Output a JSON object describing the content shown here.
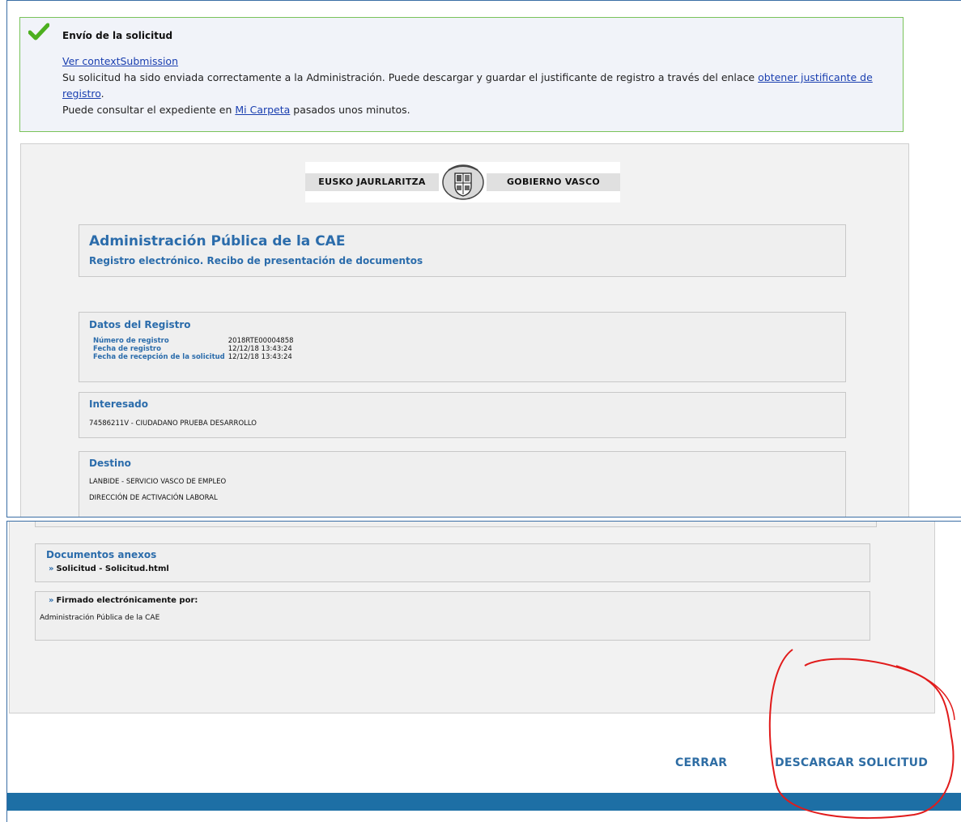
{
  "notification": {
    "title": "Envío de la solicitud",
    "context_link": "Ver contextSubmission",
    "line1_pre": "Su solicitud ha sido enviada correctamente a la Administración. Puede descargar y guardar el justificante de registro a través del enlace ",
    "line1_link": "obtener justificante de registro",
    "line1_post": ".",
    "line2_pre": "Puede consultar el expediente en ",
    "line2_link": "Mi Carpeta",
    "line2_post": " pasados unos minutos."
  },
  "logo": {
    "left": "EUSKO JAURLARITZA",
    "right": "GOBIERNO VASCO"
  },
  "receipt": {
    "title": "Administración Pública de la CAE",
    "subtitle": "Registro electrónico. Recibo de presentación de documentos",
    "registro": {
      "heading": "Datos del Registro",
      "rows": [
        {
          "label": "Número de registro",
          "value": "2018RTE00004858"
        },
        {
          "label": "Fecha de registro",
          "value": "12/12/18 13:43:24"
        },
        {
          "label": "Fecha de recepción de la solicitud",
          "value": "12/12/18 13:43:24"
        }
      ]
    },
    "interesado": {
      "heading": "Interesado",
      "value": "74586211V - CIUDADANO PRUEBA DESARROLLO"
    },
    "destino": {
      "heading": "Destino",
      "line1": "LANBIDE - SERVICIO VASCO DE EMPLEO",
      "line2": "DIRECCIÓN DE ACTIVACIÓN LABORAL"
    },
    "anexos": {
      "heading": "Documentos anexos",
      "item": "Solicitud - Solicitud.html"
    },
    "firmado": {
      "label": "Firmado electrónicamente por:",
      "value": "Administración Pública de la CAE"
    },
    "raquo": "»"
  },
  "actions": {
    "close": "CERRAR",
    "download": "DESCARGAR SOLICITUD"
  },
  "colors": {
    "accent": "#2b6cab",
    "success_border": "#79c35a",
    "footer_bar": "#1d6fa5",
    "annotation": "#e11b1b"
  }
}
